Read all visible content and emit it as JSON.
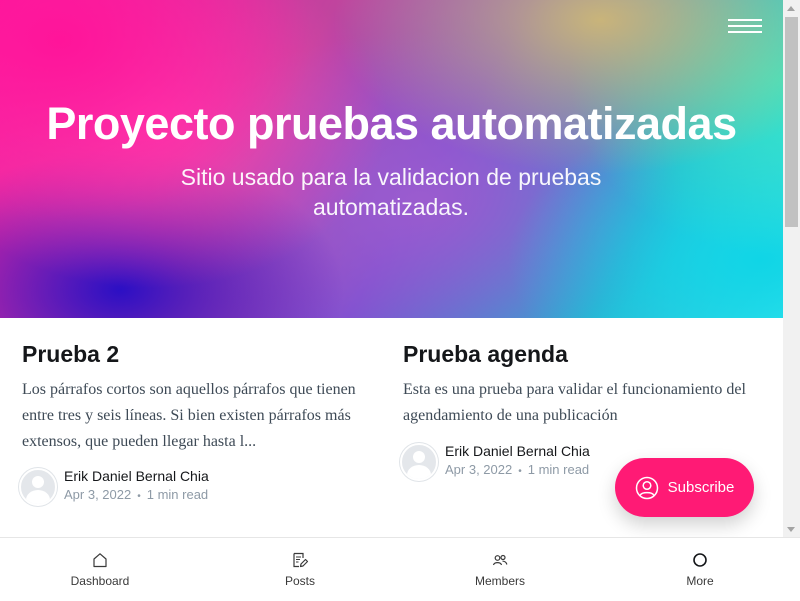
{
  "site": {
    "title": "Proyecto pruebas automatizadas",
    "description": "Sitio usado para la validacion de pruebas automatizadas."
  },
  "posts": [
    {
      "title": "Prueba 2",
      "excerpt": "Los párrafos cortos son aquellos párrafos que tienen entre tres y seis líneas. Si bien existen párrafos más extensos, que pueden llegar hasta l...",
      "author": "Erik Daniel Bernal Chia",
      "date": "Apr 3, 2022",
      "read_time": "1 min read"
    },
    {
      "title": "Prueba agenda",
      "excerpt": "Esta es una prueba para validar el funcionamiento del agendamiento de una publicación",
      "author": "Erik Daniel Bernal Chia",
      "date": "Apr 3, 2022",
      "read_time": "1 min read"
    }
  ],
  "meta_separator": "•",
  "subscribe": {
    "label": "Subscribe",
    "icon": "user-circle-icon",
    "color": "#ff1a75"
  },
  "bottom_nav": [
    {
      "label": "Dashboard",
      "icon": "home-icon"
    },
    {
      "label": "Posts",
      "icon": "posts-edit-icon"
    },
    {
      "label": "Members",
      "icon": "members-icon"
    },
    {
      "label": "More",
      "icon": "circle-icon"
    }
  ]
}
